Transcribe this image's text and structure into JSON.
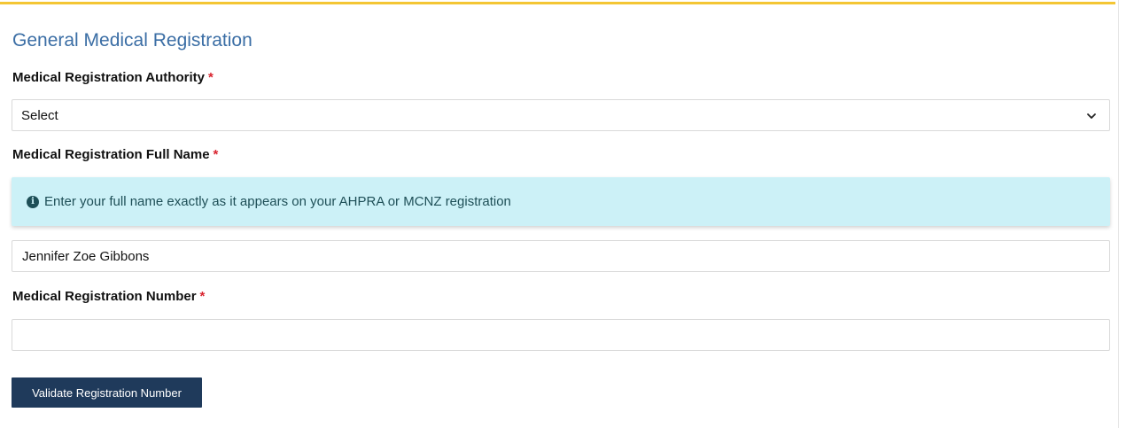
{
  "section": {
    "title": "General Medical Registration"
  },
  "fields": {
    "authority": {
      "label": "Medical Registration Authority",
      "required_marker": "*",
      "selected_value": "Select",
      "icon": "chevron-down-icon"
    },
    "full_name": {
      "label": "Medical Registration Full Name",
      "required_marker": "*",
      "info_text": "Enter your full name exactly as it appears on your AHPRA or MCNZ registration",
      "info_icon": "info-circle-icon",
      "value": "Jennifer Zoe Gibbons",
      "placeholder": ""
    },
    "number": {
      "label": "Medical Registration Number",
      "required_marker": "*",
      "value": "",
      "placeholder": ""
    }
  },
  "actions": {
    "validate_label": "Validate Registration Number"
  },
  "colors": {
    "accent_bar": "#f4c634",
    "title": "#3b6ea5",
    "required": "#d9232e",
    "info_background": "#ccf1f7",
    "info_text": "#1e4f57",
    "button_background": "#1f3a5b"
  }
}
